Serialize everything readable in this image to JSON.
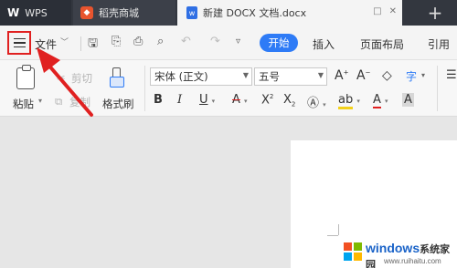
{
  "tabs": [
    {
      "label": "WPS",
      "logo": "W"
    },
    {
      "label": "稻壳商城",
      "icon": "docer-icon"
    },
    {
      "label": "新建 DOCX 文档.docx",
      "icon": "w"
    }
  ],
  "tab_controls": {
    "restore": "□",
    "close": "✕",
    "new_tab": "+"
  },
  "menubar": {
    "file_label": "文件",
    "start_label": "开始",
    "insert_label": "插入",
    "layout_label": "页面布局",
    "reference_label": "引用"
  },
  "ribbon": {
    "paste_label": "粘贴",
    "cut_label": "剪切",
    "copy_label": "复制",
    "format_painter_label": "格式刷",
    "font_name": "宋体 (正文)",
    "font_size": "五号"
  },
  "watermark": {
    "brand": "windows",
    "brand_suffix": "系统家园",
    "url": "www.ruihaitu.com"
  },
  "colors": {
    "accent": "#2e7bf6",
    "highlight_box": "#e02020",
    "arrow": "#e02020"
  }
}
